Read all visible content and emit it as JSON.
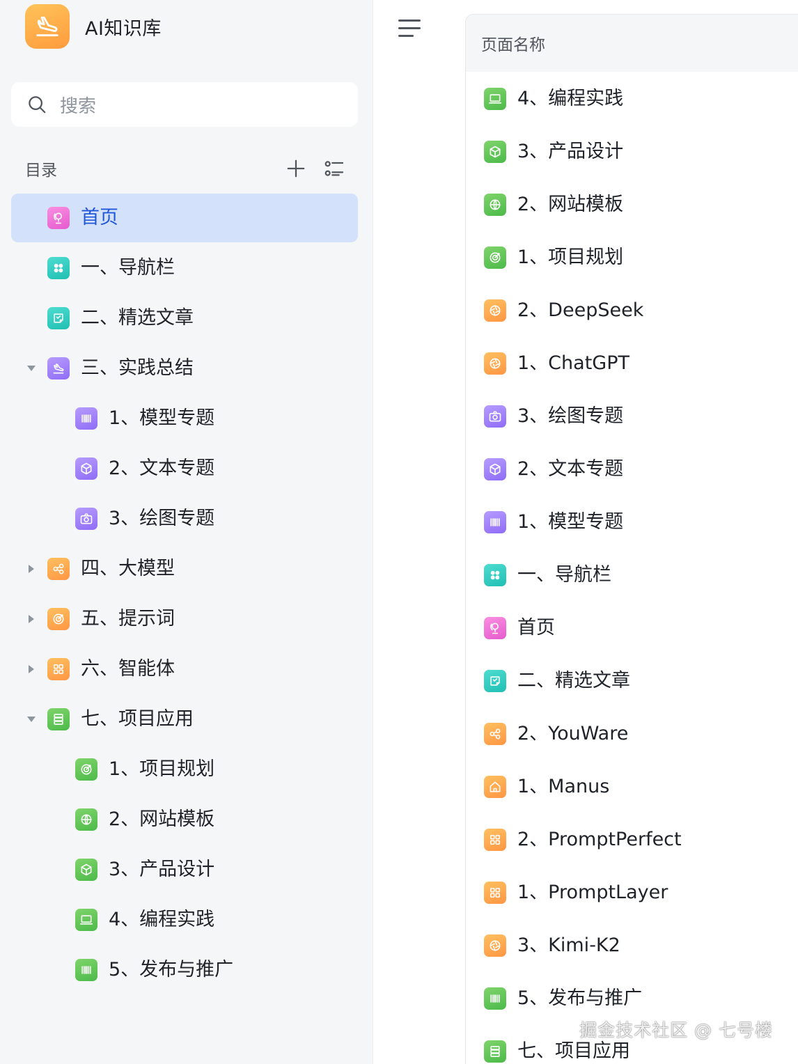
{
  "app": {
    "title": "AI知识库",
    "logo_icon": "airplane-landing-icon"
  },
  "search": {
    "placeholder": "搜索"
  },
  "toc": {
    "label": "目录",
    "add_icon": "plus-icon",
    "options_icon": "list-options-icon"
  },
  "tree": [
    {
      "label": "首页",
      "icon": "globe-pin-icon",
      "color": "#e55bcf",
      "active": true
    },
    {
      "label": "一、导航栏",
      "icon": "grid-dots-icon",
      "color": "#20bfb4"
    },
    {
      "label": "二、精选文章",
      "icon": "note-icon",
      "color": "#20bfb4"
    },
    {
      "label": "三、实践总结",
      "icon": "airplane-landing-icon",
      "color": "#8f6cf6",
      "expanded": true
    },
    {
      "label": "1、模型专题",
      "icon": "barcode-icon",
      "color": "#8f6cf6"
    },
    {
      "label": "2、文本专题",
      "icon": "cube-icon",
      "color": "#8f6cf6"
    },
    {
      "label": "3、绘图专题",
      "icon": "camera-icon",
      "color": "#8f6cf6"
    },
    {
      "label": "四、大模型",
      "icon": "nodes-icon",
      "color": "#ff9644",
      "expanded": false
    },
    {
      "label": "五、提示词",
      "icon": "target-icon",
      "color": "#ff9644",
      "expanded": false
    },
    {
      "label": "六、智能体",
      "icon": "apps-icon",
      "color": "#ff9644",
      "expanded": false
    },
    {
      "label": "七、项目应用",
      "icon": "server-icon",
      "color": "#4cba4a",
      "expanded": true
    },
    {
      "label": "1、项目规划",
      "icon": "target-icon",
      "color": "#4cba4a"
    },
    {
      "label": "2、网站模板",
      "icon": "globe-icon",
      "color": "#4cba4a"
    },
    {
      "label": "3、产品设计",
      "icon": "cube-icon",
      "color": "#4cba4a"
    },
    {
      "label": "4、编程实践",
      "icon": "laptop-icon",
      "color": "#4cba4a"
    },
    {
      "label": "5、发布与推广",
      "icon": "barcode-icon",
      "color": "#4cba4a"
    }
  ],
  "table": {
    "header": "页面名称",
    "rows": [
      {
        "label": "4、编程实践",
        "icon": "laptop-icon",
        "color": "#4cba4a"
      },
      {
        "label": "3、产品设计",
        "icon": "cube-icon",
        "color": "#4cba4a"
      },
      {
        "label": "2、网站模板",
        "icon": "globe-icon",
        "color": "#4cba4a"
      },
      {
        "label": "1、项目规划",
        "icon": "target-icon",
        "color": "#4cba4a"
      },
      {
        "label": "2、DeepSeek",
        "icon": "aperture-icon",
        "color": "#ff9644"
      },
      {
        "label": "1、ChatGPT",
        "icon": "aperture-icon",
        "color": "#ff9644"
      },
      {
        "label": "3、绘图专题",
        "icon": "camera-icon",
        "color": "#8f6cf6"
      },
      {
        "label": "2、文本专题",
        "icon": "cube-icon",
        "color": "#8f6cf6"
      },
      {
        "label": "1、模型专题",
        "icon": "barcode-icon",
        "color": "#8f6cf6"
      },
      {
        "label": "一、导航栏",
        "icon": "grid-dots-icon",
        "color": "#20bfb4"
      },
      {
        "label": "首页",
        "icon": "globe-pin-icon",
        "color": "#e55bcf"
      },
      {
        "label": "二、精选文章",
        "icon": "note-icon",
        "color": "#20bfb4"
      },
      {
        "label": "2、YouWare",
        "icon": "nodes-icon",
        "color": "#ff9644"
      },
      {
        "label": "1、Manus",
        "icon": "home-icon",
        "color": "#ff9644"
      },
      {
        "label": "2、PromptPerfect",
        "icon": "apps-icon",
        "color": "#ff9644"
      },
      {
        "label": "1、PromptLayer",
        "icon": "apps-icon",
        "color": "#ff9644"
      },
      {
        "label": "3、Kimi-K2",
        "icon": "aperture-icon",
        "color": "#ff9644"
      },
      {
        "label": "5、发布与推广",
        "icon": "barcode-icon",
        "color": "#4cba4a"
      },
      {
        "label": "七、项目应用",
        "icon": "server-icon",
        "color": "#4cba4a"
      }
    ]
  },
  "watermark": "掘金技术社区 @ 七号楼"
}
